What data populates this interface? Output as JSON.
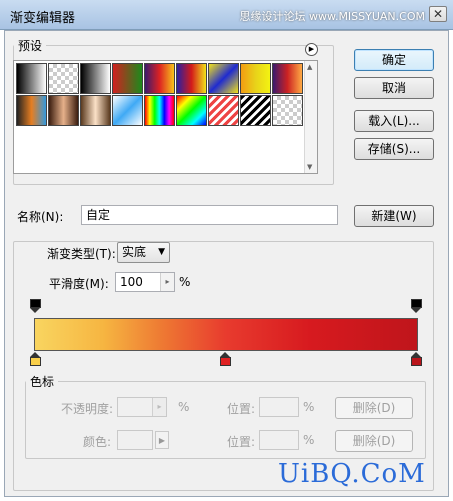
{
  "window": {
    "title": "渐变编辑器",
    "watermark": "思缘设计论坛 www.MISSYUAN.COM",
    "close_glyph": "✕"
  },
  "buttons": {
    "ok": "确定",
    "cancel": "取消",
    "load": "载入(L)...",
    "save": "存储(S)...",
    "new": "新建(W)",
    "delete_opacity": "删除(D)",
    "delete_color": "删除(D)"
  },
  "presets": {
    "legend": "预设",
    "menu_glyph": "▶",
    "swatches": [
      "linear-gradient(90deg,#000,#fff)",
      "repeating-conic-gradient(#ccc 0% 25%, #fff 0% 50%) 0 0/8px 8px",
      "linear-gradient(90deg,#000,#fff)",
      "linear-gradient(90deg,#d12020,#1c8a1c)",
      "linear-gradient(90deg,#3a1a6e,#d22,#f7c21b)",
      "linear-gradient(90deg,#2a1fa0,#d31a1a,#f2e31a)",
      "linear-gradient(135deg,#f2e31a,#1f2bd0,#f2e31a)",
      "linear-gradient(90deg,#f39c12,#e8d21a,#f3f312)",
      "linear-gradient(90deg,#3a1a6e,#c22,#fa4)",
      "linear-gradient(90deg,#222,#e67e22,#3498db)",
      "linear-gradient(90deg,#3b1d0f,#e6b08a,#3b1d0f)",
      "linear-gradient(90deg,#5a3a1f,#fbe1c7,#5a3a1f)",
      "linear-gradient(135deg,#fff,#3fa9f5,#fff)",
      "linear-gradient(90deg,#f00,#ff0,#0f0,#0ff,#00f,#f0f,#f00)",
      "linear-gradient(135deg,#f00,#ff0,#0f0,#0ff,#00f)",
      "repeating-linear-gradient(135deg,#e44 0 3px,#fff 3px 6px)",
      "repeating-linear-gradient(135deg,#000 0 3px,#fff 3px 6px)",
      "repeating-conic-gradient(#ccc 0% 25%, #fff 0% 50%) 0 0/8px 8px"
    ]
  },
  "name_field": {
    "label": "名称(N):",
    "value": "自定"
  },
  "gradient_type": {
    "legend_label": "渐变类型(T):",
    "selected": "实底",
    "arrow_glyph": "▼"
  },
  "smoothness": {
    "label": "平滑度(M):",
    "value": "100",
    "unit": "%",
    "arrow_glyph": "▸"
  },
  "gradient": {
    "css": "linear-gradient(90deg,#f9d560 0%,#f6b541 18%,#ee7a33 33%,#e83b2e 50%,#d71a1f 72%,#bf151b 100%)",
    "color_stop_colors": [
      "#f9cf4a",
      "#e02223",
      "#b9141a"
    ]
  },
  "color_stop_section": {
    "legend": "色标",
    "opacity_label": "不透明度:",
    "opacity_unit": "%",
    "location_label": "位置:",
    "location_unit": "%",
    "color_label": "颜色:",
    "location2_label": "位置:",
    "location2_unit": "%",
    "color_arrow_glyph": "▶"
  },
  "bottom_watermark": "UiBQ.CoM",
  "colors": {
    "watermark_blue": "#2b6bd8"
  }
}
